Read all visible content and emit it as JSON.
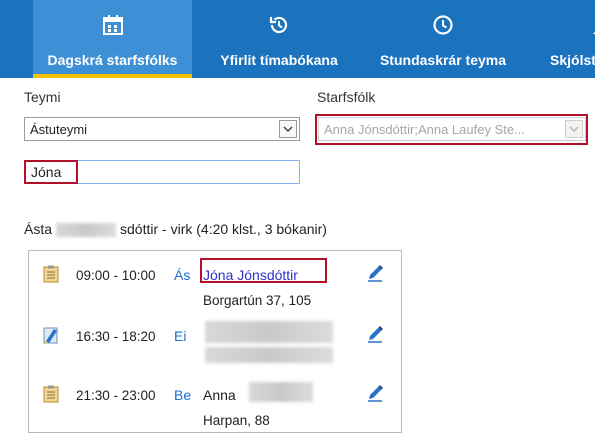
{
  "nav": {
    "tabs": [
      {
        "label": "Dagskrá starfsfólks",
        "icon": "calendar-icon",
        "active": true
      },
      {
        "label": "Yfirlit tímabókana",
        "icon": "history-icon",
        "active": false
      },
      {
        "label": "Stundaskrár teyma",
        "icon": "clock-icon",
        "active": false
      },
      {
        "label": "Skjólst",
        "icon": "person-icon",
        "active": false
      }
    ],
    "colors": {
      "bar": "#1b73bd",
      "active": "#3e90d6",
      "underline": "#f2c300"
    }
  },
  "filters": {
    "team_label": "Teymi",
    "team_value": "Ástuteymi",
    "staff_label": "Starfsfólk",
    "staff_value": "Anna Jónsdóttir;Anna Laufey Ste...",
    "search_value": "Jóna"
  },
  "staff": {
    "name_start": "Ásta",
    "name_end": "sdóttir",
    "summary": " - virk (4:20 klst., 3 bókanir)"
  },
  "bookings": [
    {
      "time": "09:00 - 10:00",
      "code": "Ás",
      "name": "Jóna Jónsdóttir",
      "address": "Borgartún 37, 105",
      "icon": "clipboard-icon"
    },
    {
      "time": "16:30 - 18:20",
      "code": "Ei",
      "name": "",
      "address": "",
      "icon": "notepad-pen-icon"
    },
    {
      "time": "21:30 - 23:00",
      "code": "Be",
      "name": "Anna",
      "address": "Harpan, 88",
      "icon": "clipboard-icon"
    }
  ],
  "highlight_color": "#b0102a"
}
